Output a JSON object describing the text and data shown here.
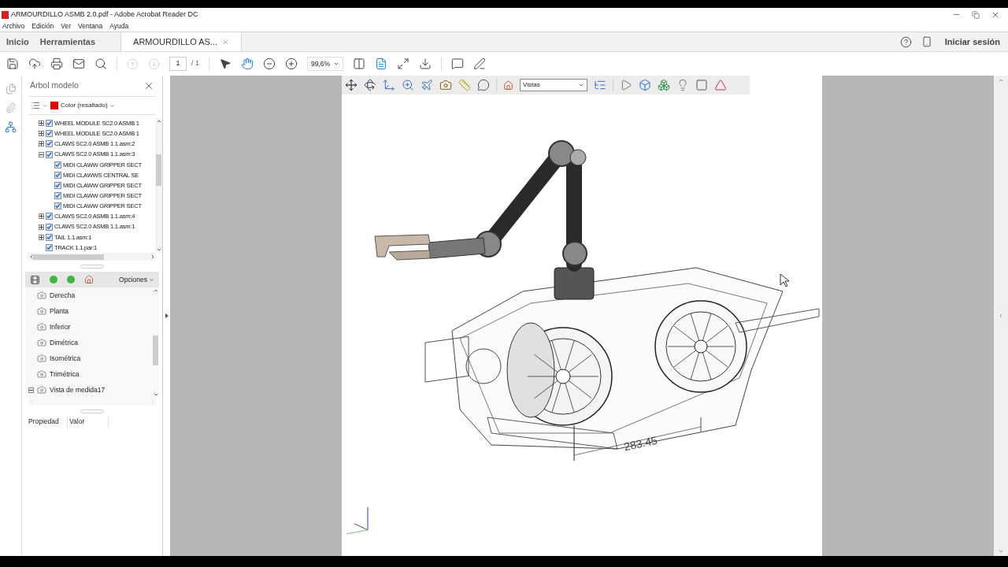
{
  "window": {
    "title": "ARMOURDILLO ASMB 2.0.pdf - Adobe Acrobat Reader DC"
  },
  "menu": [
    "Archivo",
    "Edición",
    "Ver",
    "Ventana",
    "Ayuda"
  ],
  "tabs": [
    {
      "label": "Inicio",
      "selected": false
    },
    {
      "label": "Herramientas",
      "selected": false
    },
    {
      "label": "ARMOURDILLO AS...",
      "selected": true
    }
  ],
  "account": {
    "label": "Iniciar sesión"
  },
  "toolbar": {
    "page": "1",
    "page_total": "/ 1",
    "zoom": "99,6%",
    "previous_disabled": true,
    "next_disabled": true,
    "hand_tool_active": true
  },
  "model_tree": {
    "title": "Árbol modelo",
    "color_mode": "Color (resaltado)",
    "items": [
      {
        "label": "WHEEL MODULE SC2.0 ASMB 1",
        "checked": true,
        "expanded": false
      },
      {
        "label": "WHEEL MODULE SC2.0 ASMB 1",
        "checked": true,
        "expanded": false
      },
      {
        "label": "CLAWS SC2.0 ASMB 1.1.asm:2",
        "checked": true,
        "expanded": false
      },
      {
        "label": "CLAWS SC2.0 ASMB 1.1.asm:3",
        "checked": true,
        "expanded": true,
        "children": [
          {
            "label": "MIDI CLAWW GRIPPER SECT",
            "checked": true
          },
          {
            "label": "MIDI CLAWWS CENTRAL SE",
            "checked": true
          },
          {
            "label": "MIDI CLAWW GRIPPER SECT",
            "checked": true
          },
          {
            "label": "MIDI CLAWW GRIPPER SECT",
            "checked": true
          },
          {
            "label": "MIDI CLAWW GRIPPER SECT",
            "checked": true
          }
        ]
      },
      {
        "label": "CLAWS SC2.0 ASMB 1.1.asm:4",
        "checked": true,
        "expanded": false
      },
      {
        "label": "CLAWS SC2.0 ASMB 1.1.asm:1",
        "checked": true,
        "expanded": false
      },
      {
        "label": "TAIL 1.1.asm:1",
        "checked": true,
        "expanded": false
      },
      {
        "label": "TRACK 1.1.par:1",
        "checked": true
      }
    ]
  },
  "views": {
    "options": "Opciones",
    "items": [
      {
        "label": "Derecha"
      },
      {
        "label": "Planta"
      },
      {
        "label": "Inferior"
      },
      {
        "label": "Dimétrica"
      },
      {
        "label": "Isométrica"
      },
      {
        "label": "Trimétrica"
      },
      {
        "label": "Vista de medida17",
        "expanded": true
      }
    ]
  },
  "properties": {
    "columns": [
      "Propiedad",
      "Valor"
    ]
  },
  "viewer_toolbar": {
    "views_select": "Vistas"
  },
  "model": {
    "dimension": "283.45"
  }
}
